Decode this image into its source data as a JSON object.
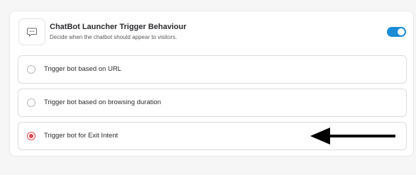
{
  "header": {
    "title": "ChatBot Launcher Trigger Behaviour",
    "subtitle": "Decide when the chatbot should appear to visitors.",
    "icon": "chat-bubble-icon",
    "toggle_enabled": true,
    "accent_color": "#1a8cd8"
  },
  "options": [
    {
      "label": "Trigger bot based on URL",
      "selected": false
    },
    {
      "label": "Trigger bot based on browsing duration",
      "selected": false
    },
    {
      "label": "Trigger bot for Exit Intent",
      "selected": true
    }
  ],
  "selected_color": "#e0454f",
  "annotation": {
    "icon": "arrow-left-icon"
  }
}
